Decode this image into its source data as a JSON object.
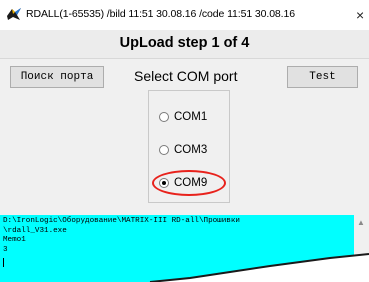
{
  "window": {
    "title": "RDALL(1-65535) /bild 11:51 30.08.16 /code 11:51 30.08.16",
    "close_label": "×"
  },
  "step": {
    "title": "UpLoad step 1 of 4"
  },
  "toolbar": {
    "find_port_label": "Поиск порта",
    "select_label": "Select COM port",
    "test_label": "Test"
  },
  "com_ports": {
    "options": [
      "COM1",
      "COM3",
      "COM9"
    ],
    "selected": "COM9"
  },
  "memo": {
    "label": "Memo1",
    "lines": [
      "D:\\IronLogic\\Оборудование\\MATRIX-III RD-all\\Прошивки",
      "\\rdall_V31.exe",
      "Memo1",
      "3"
    ]
  },
  "colors": {
    "memo_background": "#00ffff",
    "highlight": "#e8221c"
  }
}
